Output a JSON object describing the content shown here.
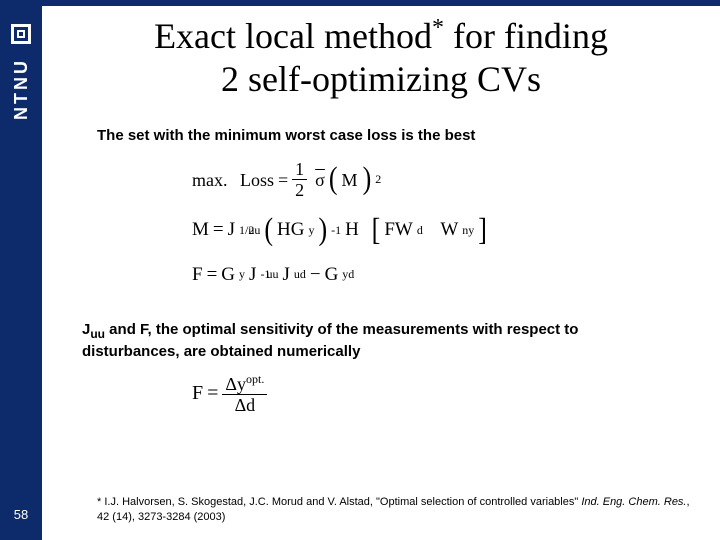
{
  "sidebar": {
    "org": "NTNU"
  },
  "slide_number": "58",
  "title": {
    "part1": "Exact local method",
    "star": "*",
    "part2": " for finding",
    "line2": "2 self-optimizing CVs"
  },
  "text1": "The set with the minimum worst case loss is the best",
  "eq1": {
    "lhs_label": "max.",
    "lhs_loss": "Loss",
    "eq": "=",
    "num": "1",
    "den": "2",
    "sigma_bar": "σ",
    "big_l": "(",
    "big_r": ")",
    "exp2": "2"
  },
  "eq_M": {
    "M": "M",
    "eq": "=",
    "J": "J",
    "uu": "uu",
    "half": "1/2",
    "l": "(",
    "HG": "HG",
    "y": "y",
    "r": ")",
    "neg1": "-1",
    "H": "H",
    "bl": "[",
    "FW": "FW",
    "d": "d",
    "sp": " ",
    "W": "W",
    "ny": "ny",
    "br": "]"
  },
  "eq_F": {
    "F": "F",
    "eq": "=",
    "G": "G",
    "y": "y",
    "J": "J",
    "uu": "uu",
    "neg1": "-1",
    "Jud": "J",
    "ud": "ud",
    "minus": "−",
    "G2": "G",
    "y2": "y",
    "d": "d"
  },
  "juu_text_pre": "J",
  "juu_sub": "uu",
  "juu_text_post": " and F, the optimal sensitivity of the measurements with respect to disturbances, are obtained numerically",
  "eq_Fbig": {
    "F": "F",
    "eq": "=",
    "num_delta": "Δy",
    "num_sup": "opt.",
    "den_delta": "Δd"
  },
  "footnote": {
    "star": "* ",
    "authors": "I.J. Halvorsen, S. Skogestad, J.C. Morud and V. Alstad, ",
    "title_quote": "\"Optimal selection of controlled variables\" ",
    "journal": "Ind. Eng. Chem. Res.",
    "rest": ", 42 (14), 3273-3284  (2003)"
  }
}
